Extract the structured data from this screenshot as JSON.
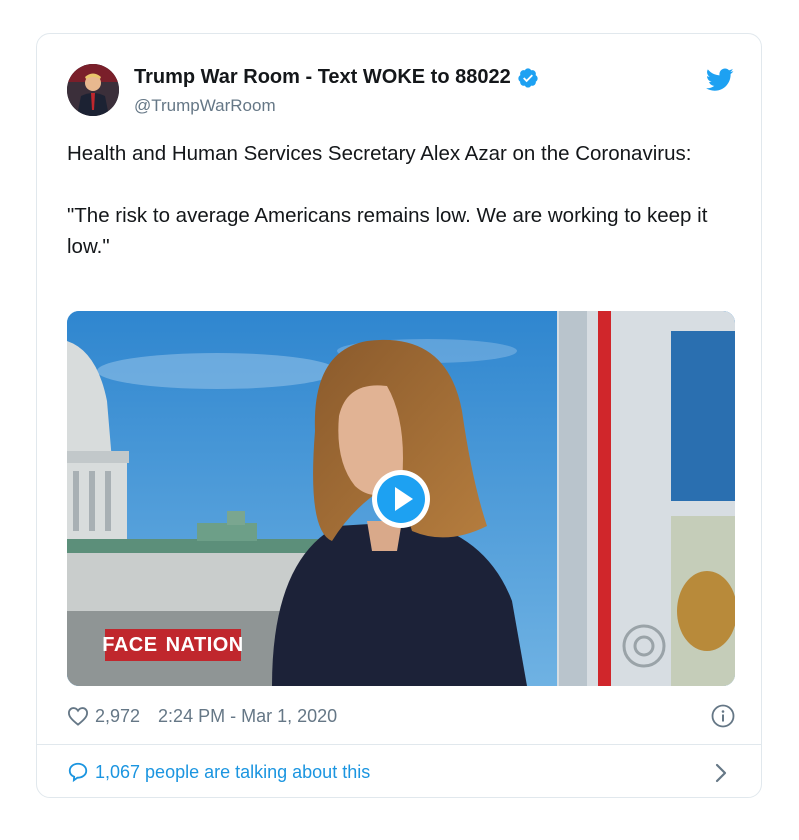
{
  "tweet": {
    "display_name": "Trump War Room - Text WOKE to 88022",
    "handle": "@TrumpWarRoom",
    "text": "Health and Human Services Secretary Alex Azar on the Coronavirus:\n\n\"The risk to average Americans remains low. We are working to keep it low.\"",
    "likes": "2,972",
    "timestamp": "2:24 PM - Mar 1, 2020",
    "talking": "1,067 people are talking about this"
  },
  "video": {
    "program_logo_left": "FACE",
    "program_logo_right": "NATION"
  },
  "icons": {
    "verified": "verified-badge-icon",
    "bird": "twitter-bird-icon",
    "play": "play-icon",
    "heart": "heart-icon",
    "info": "info-icon",
    "bubble": "comment-bubble-icon",
    "chevron": "chevron-right-icon"
  },
  "colors": {
    "accent": "#1da1f2",
    "link": "#1b95e0",
    "secondary_text": "#657786",
    "border": "#e1e8ed"
  }
}
